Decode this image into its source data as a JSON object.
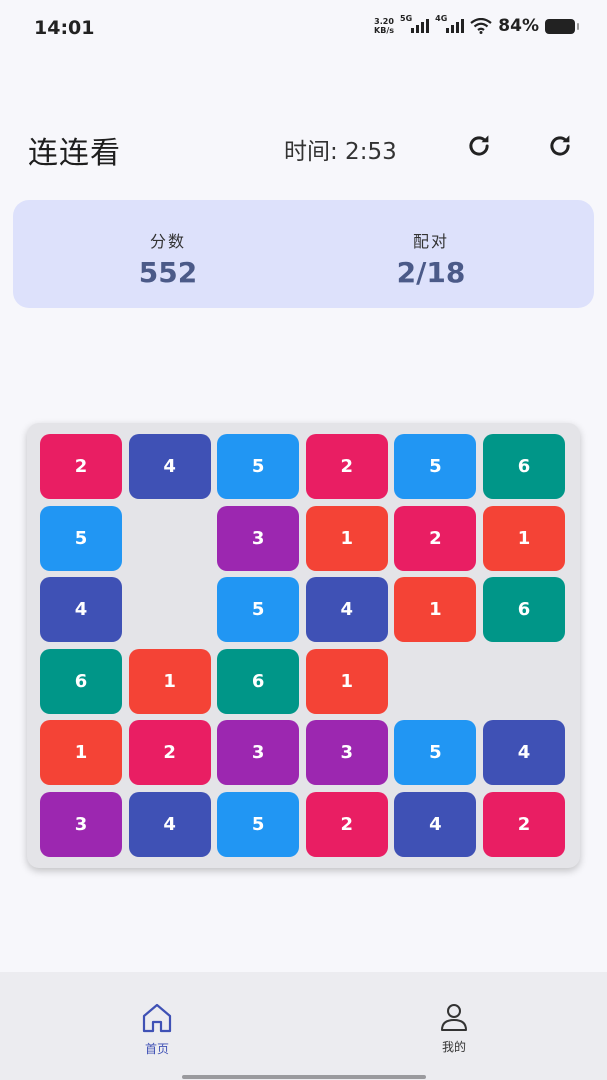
{
  "status_bar": {
    "time": "14:01",
    "net_speed_value": "3.20",
    "net_speed_unit": "KB/s",
    "signal_1_label": "5G",
    "signal_2_label": "4G",
    "battery_text": "84%",
    "battery_level": 0.84
  },
  "header": {
    "title": "连连看",
    "timer_text": "时间: 2:53",
    "refresh_icon": "refresh-icon",
    "restart_icon": "restart-icon"
  },
  "stats": {
    "score_label": "分数",
    "score_value": "552",
    "pairs_label": "配对",
    "pairs_value": "2/18"
  },
  "colors": {
    "1": "#f44336",
    "2": "#e91e63",
    "3": "#9c27b0",
    "4": "#3f51b5",
    "5": "#2196f3",
    "6": "#009688"
  },
  "board": {
    "rows": [
      [
        "2",
        "4",
        "5",
        "2",
        "5",
        "6"
      ],
      [
        "5",
        "",
        "3",
        "1",
        "2",
        "1"
      ],
      [
        "4",
        "",
        "5",
        "4",
        "1",
        "6"
      ],
      [
        "6",
        "1",
        "6",
        "1",
        "",
        ""
      ],
      [
        "1",
        "2",
        "3",
        "3",
        "5",
        "4"
      ],
      [
        "3",
        "4",
        "5",
        "2",
        "4",
        "2"
      ]
    ]
  },
  "nav": {
    "home_label": "首页",
    "home_icon": "home-icon",
    "profile_label": "我的",
    "profile_icon": "person-icon",
    "accent": "#3f51b5"
  }
}
